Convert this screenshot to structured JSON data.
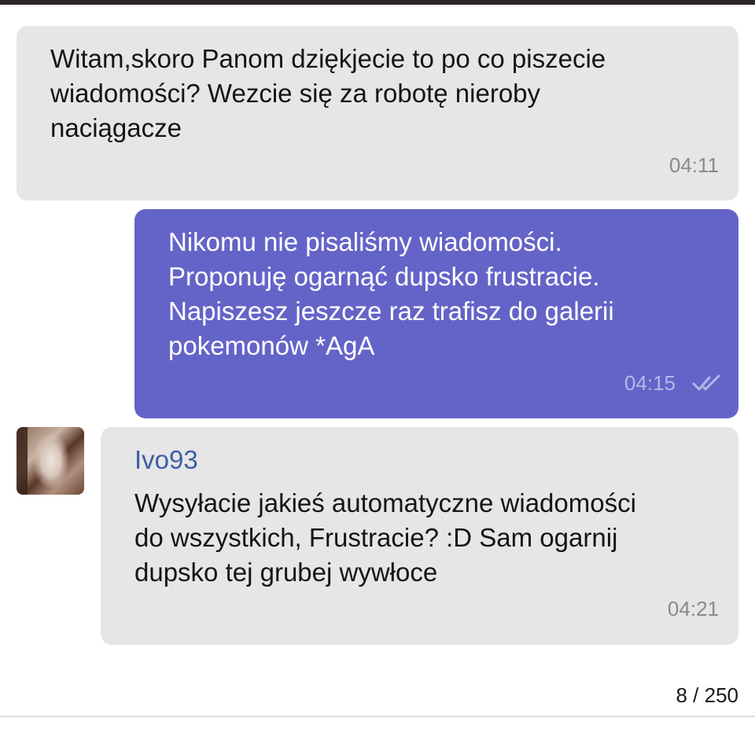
{
  "messages": [
    {
      "direction": "incoming",
      "text": "Witam,skoro Panom dziękjecie to po co piszecie\nwiadomości? Wezcie się za robotę nieroby\nnaciągacze",
      "time": "04:11"
    },
    {
      "direction": "outgoing",
      "text": "Nikomu nie pisaliśmy wiadomości.\nProponuję ogarnąć dupsko frustracie.\nNapiszesz jeszcze raz trafisz do galerii\npokemonów *AgA",
      "time": "04:15",
      "status_icon": "double-check-icon"
    },
    {
      "direction": "incoming",
      "sender": "Ivo93",
      "text": "Wysyłacie jakieś automatyczne wiadomości\ndo wszystkich, Frustracie? :D Sam ogarnij\ndupsko tej grubej wywłoce",
      "time": "04:21"
    }
  ],
  "counter": "8 / 250",
  "colors": {
    "incoming_bubble": "#e6e6e6",
    "outgoing_bubble": "#6464c8",
    "sender_name": "#3d5ea6"
  }
}
